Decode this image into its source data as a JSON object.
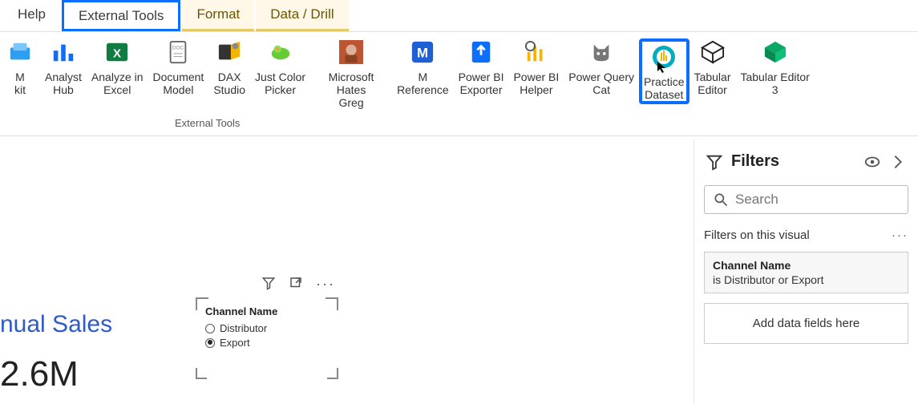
{
  "tabs": {
    "help": "Help",
    "external": "External Tools",
    "format": "Format",
    "datadrill": "Data / Drill"
  },
  "ribbon": {
    "group_label": "External Tools",
    "items": [
      {
        "id": "kit",
        "label": "M\nkit"
      },
      {
        "id": "analyst-hub",
        "label": "Analyst\nHub"
      },
      {
        "id": "analyze-excel",
        "label": "Analyze in\nExcel"
      },
      {
        "id": "document-model",
        "label": "Document\nModel"
      },
      {
        "id": "dax-studio",
        "label": "DAX\nStudio"
      },
      {
        "id": "color-picker",
        "label": "Just Color\nPicker"
      },
      {
        "id": "ms-hates-greg",
        "label": "Microsoft Hates\nGreg"
      },
      {
        "id": "m-reference",
        "label": "M\nReference"
      },
      {
        "id": "pbi-exporter",
        "label": "Power BI\nExporter"
      },
      {
        "id": "pbi-helper",
        "label": "Power BI\nHelper"
      },
      {
        "id": "pq-cat",
        "label": "Power Query\nCat"
      },
      {
        "id": "practice-dataset",
        "label": "Practice\nDataset"
      },
      {
        "id": "tabular-editor",
        "label": "Tabular\nEditor"
      },
      {
        "id": "tabular-editor3",
        "label": "Tabular Editor\n3"
      }
    ]
  },
  "canvas": {
    "title": "nual Sales",
    "value": "2.6M",
    "slicer": {
      "title": "Channel Name",
      "options": [
        {
          "label": "Distributor",
          "checked": false
        },
        {
          "label": "Export",
          "checked": true
        }
      ]
    }
  },
  "filters": {
    "title": "Filters",
    "search_placeholder": "Search",
    "section": "Filters on this visual",
    "card": {
      "title": "Channel Name",
      "sub": "is Distributor or Export"
    },
    "add_label": "Add data fields here"
  }
}
